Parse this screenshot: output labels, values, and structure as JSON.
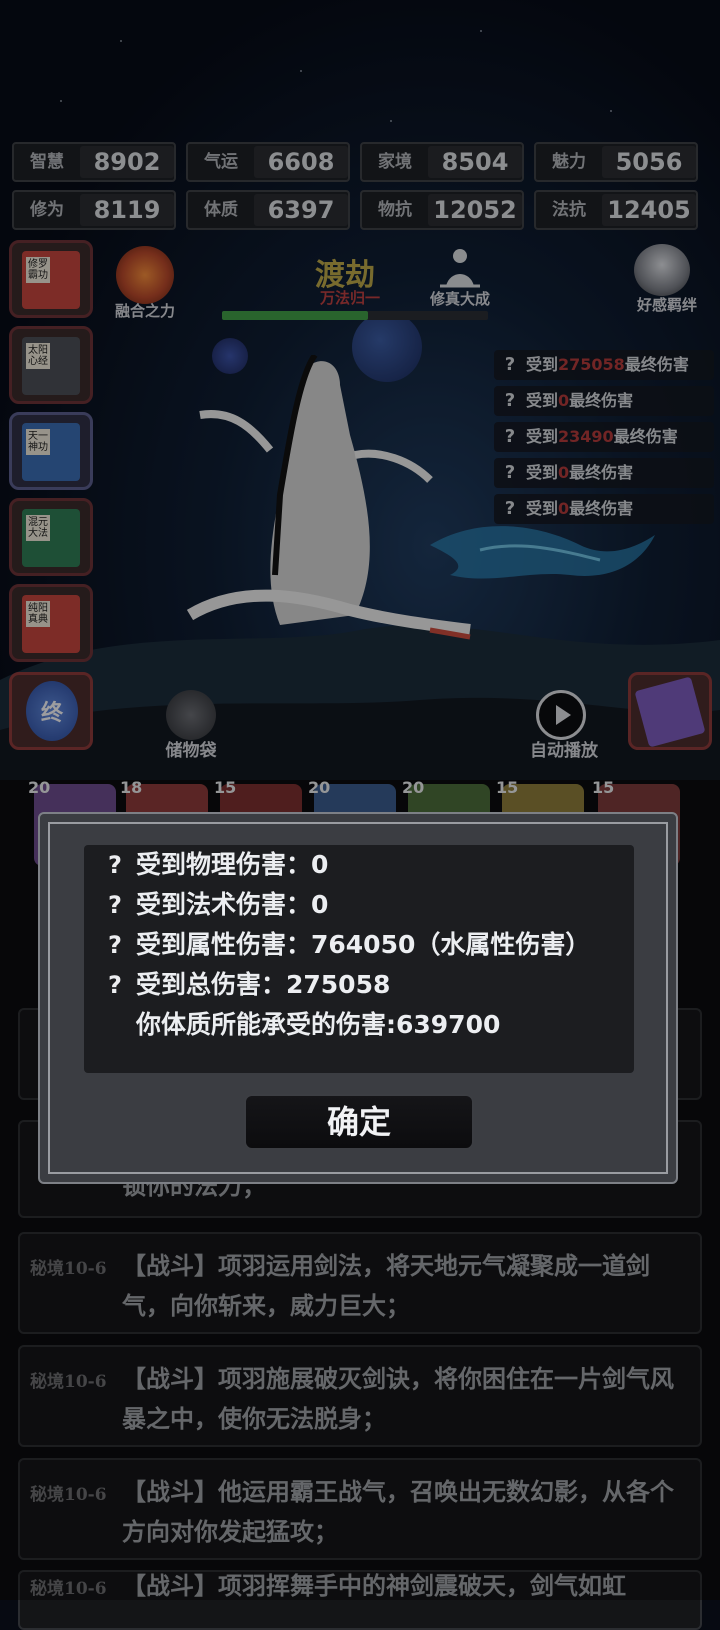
{
  "stats": [
    {
      "label": "智慧",
      "value": "8902"
    },
    {
      "label": "气运",
      "value": "6608"
    },
    {
      "label": "家境",
      "value": "8504"
    },
    {
      "label": "魅力",
      "value": "5056"
    },
    {
      "label": "修为",
      "value": "8119"
    },
    {
      "label": "体质",
      "value": "6397"
    },
    {
      "label": "物抗",
      "value": "12052"
    },
    {
      "label": "法抗",
      "value": "12405"
    }
  ],
  "top_bar": {
    "fusion_label": "融合之力",
    "stage_title": "渡劫",
    "stage_subtitle": "万法归一",
    "stage_progress": 0.55,
    "cultivate_label": "修真大成",
    "affinity_label": "好感羁绊"
  },
  "books": [
    {
      "title": "修罗霸功",
      "color": "#c0443c"
    },
    {
      "title": "太阳心经",
      "color": "#4a4d55"
    },
    {
      "title": "天一神功",
      "color": "#3a6bb0"
    },
    {
      "title": "混元大法",
      "color": "#2f7a54"
    },
    {
      "title": "纯阳真典",
      "color": "#c0443c"
    }
  ],
  "damage_list": [
    {
      "prefix": "受到",
      "value": "275058",
      "suffix": "最终伤害"
    },
    {
      "prefix": "受到",
      "value": "0",
      "suffix": "最终伤害"
    },
    {
      "prefix": "受到",
      "value": "23490",
      "suffix": "最终伤害"
    },
    {
      "prefix": "受到",
      "value": "0",
      "suffix": "最终伤害"
    },
    {
      "prefix": "受到",
      "value": "0",
      "suffix": "最终伤害"
    }
  ],
  "controls": {
    "final_label": "终",
    "bag_label": "储物袋",
    "auto_play_label": "自动播放"
  },
  "slots": [
    "20",
    "18",
    "15",
    "20",
    "20",
    "15",
    "15"
  ],
  "dialog": {
    "rows": [
      {
        "q": "?",
        "text": "受到物理伤害：0"
      },
      {
        "q": "?",
        "text": "受到法术伤害：0"
      },
      {
        "q": "?",
        "text": "受到属性伤害：764050（水属性伤害）"
      },
      {
        "q": "?",
        "text": "受到总伤害：275058"
      },
      {
        "q": "",
        "text": "你体质所能承受的伤害:639700"
      }
    ],
    "confirm_label": "确定"
  },
  "log_partial": "锁你的法力；",
  "logs": [
    {
      "tag": "秘境10-6",
      "text": "【战斗】项羽运用剑法，将天地元气凝聚成一道剑气，向你斩来，威力巨大；"
    },
    {
      "tag": "秘境10-6",
      "text": "【战斗】项羽施展破灭剑诀，将你困住在一片剑气风暴之中，使你无法脱身；"
    },
    {
      "tag": "秘境10-6",
      "text": "【战斗】他运用霸王战气，召唤出无数幻影，从各个方向对你发起猛攻；"
    },
    {
      "tag": "秘境10-6",
      "text": "【战斗】项羽挥舞手中的神剑震破天，剑气如虹"
    }
  ]
}
